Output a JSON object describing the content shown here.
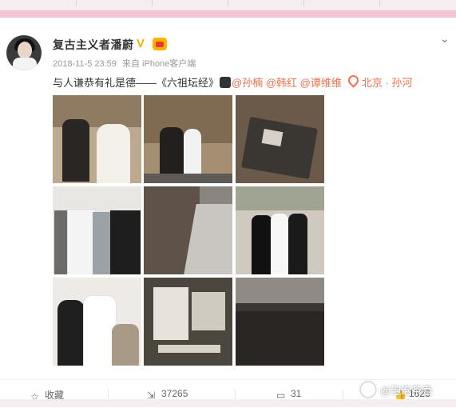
{
  "post": {
    "username": "复古主义者潘蔚",
    "verified_badge": "V",
    "timestamp": "2018-11-5 23:59",
    "source": "来自 iPhone客户端",
    "text_main": "与人谦恭有礼是德——《六祖坛经》",
    "mentions": [
      "@孙楠",
      "@韩红",
      "@谭维维"
    ],
    "location": "北京 · 孙河",
    "image_count": 9
  },
  "actions": {
    "favorite_label": "收藏",
    "repost_count": "37265",
    "comment_count": "31",
    "like_count": "1626"
  },
  "watermark": {
    "text": "@泡泡茶壶"
  },
  "icons": {
    "avatar": "avatar",
    "verified": "verified-v-icon",
    "vip": "vip-badge-icon",
    "menu": "chevron-down-icon",
    "emoji": "emoji-icon",
    "location": "location-pin-icon",
    "favorite": "star-icon",
    "repost": "share-icon",
    "comment": "comment-icon",
    "like": "thumb-up-icon"
  },
  "colors": {
    "accent": "#eb7350",
    "badge": "#f1b200",
    "top_bar": "#f2c4d5"
  }
}
